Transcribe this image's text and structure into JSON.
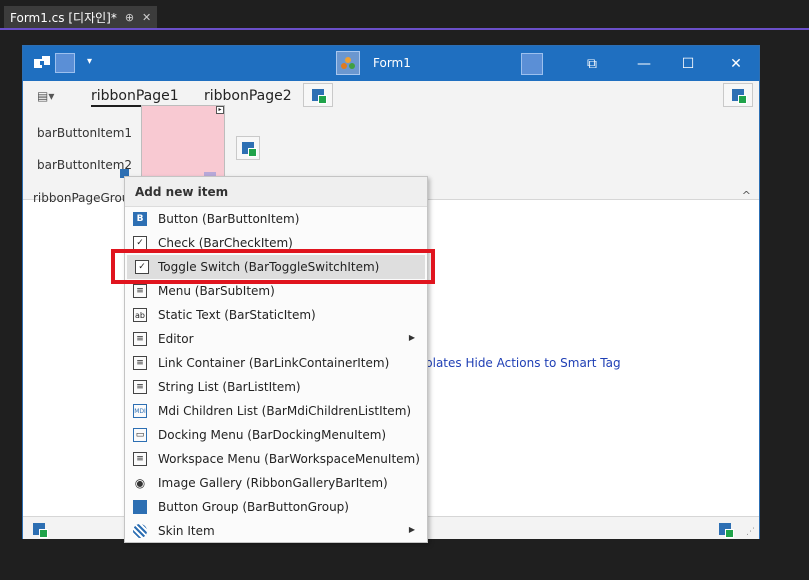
{
  "tab": {
    "label": "Form1.cs [디자인]*",
    "pin": "⊕",
    "close": "✕"
  },
  "form": {
    "title": "Form1",
    "qa_dropdown": "▾",
    "window_buttons": {
      "restore_alt": "⧉",
      "minimize": "—",
      "maximize": "☐",
      "close": "✕"
    }
  },
  "ribbon": {
    "app_menu": "▤▾",
    "tabs": [
      {
        "label": "ribbonPage1"
      },
      {
        "label": "ribbonPage2"
      }
    ],
    "items": [
      {
        "label": "barButtonItem1"
      },
      {
        "label": "barButtonItem2"
      }
    ],
    "group_label": "ribbonPageGrou...",
    "collapse": "^"
  },
  "smart_tag_links": "plates  Hide Actions to Smart Tag",
  "menu": {
    "header": "Add new item",
    "items": [
      {
        "label": "Button (BarButtonItem)",
        "icon": "button-icon",
        "glyph": "B",
        "submenu": false
      },
      {
        "label": "Check (BarCheckItem)",
        "icon": "check-icon",
        "glyph": "✓",
        "submenu": false
      },
      {
        "label": "Toggle Switch (BarToggleSwitchItem)",
        "icon": "toggle-switch-icon",
        "glyph": "✓",
        "submenu": false,
        "highlighted": true
      },
      {
        "label": "Menu (BarSubItem)",
        "icon": "menu-icon",
        "glyph": "≡",
        "submenu": false
      },
      {
        "label": "Static Text (BarStaticItem)",
        "icon": "static-text-icon",
        "glyph": "ab",
        "submenu": false
      },
      {
        "label": "Editor",
        "icon": "editor-icon",
        "glyph": "≡",
        "submenu": true
      },
      {
        "label": "Link Container (BarLinkContainerItem)",
        "icon": "link-container-icon",
        "glyph": "≡",
        "submenu": false
      },
      {
        "label": "String List (BarListItem)",
        "icon": "string-list-icon",
        "glyph": "≡",
        "submenu": false
      },
      {
        "label": "Mdi Children List (BarMdiChildrenListItem)",
        "icon": "mdi-list-icon",
        "glyph": "MDI",
        "submenu": false
      },
      {
        "label": "Docking Menu (BarDockingMenuItem)",
        "icon": "docking-menu-icon",
        "glyph": "▭",
        "submenu": false
      },
      {
        "label": "Workspace Menu (BarWorkspaceMenuItem)",
        "icon": "workspace-menu-icon",
        "glyph": "≡",
        "submenu": false
      },
      {
        "label": "Image Gallery (RibbonGalleryBarItem)",
        "icon": "eye-icon",
        "glyph": "◉",
        "submenu": false
      },
      {
        "label": "Button Group (BarButtonGroup)",
        "icon": "button-group-icon",
        "glyph": "",
        "submenu": false
      },
      {
        "label": "Skin Item",
        "icon": "skin-icon",
        "glyph": "",
        "submenu": true
      }
    ],
    "submenu_arrow": "▶"
  },
  "colors": {
    "title_bar": "#1f6fc0",
    "highlight_border": "#e0141e",
    "selected_item_bg": "#f8c9d2"
  }
}
